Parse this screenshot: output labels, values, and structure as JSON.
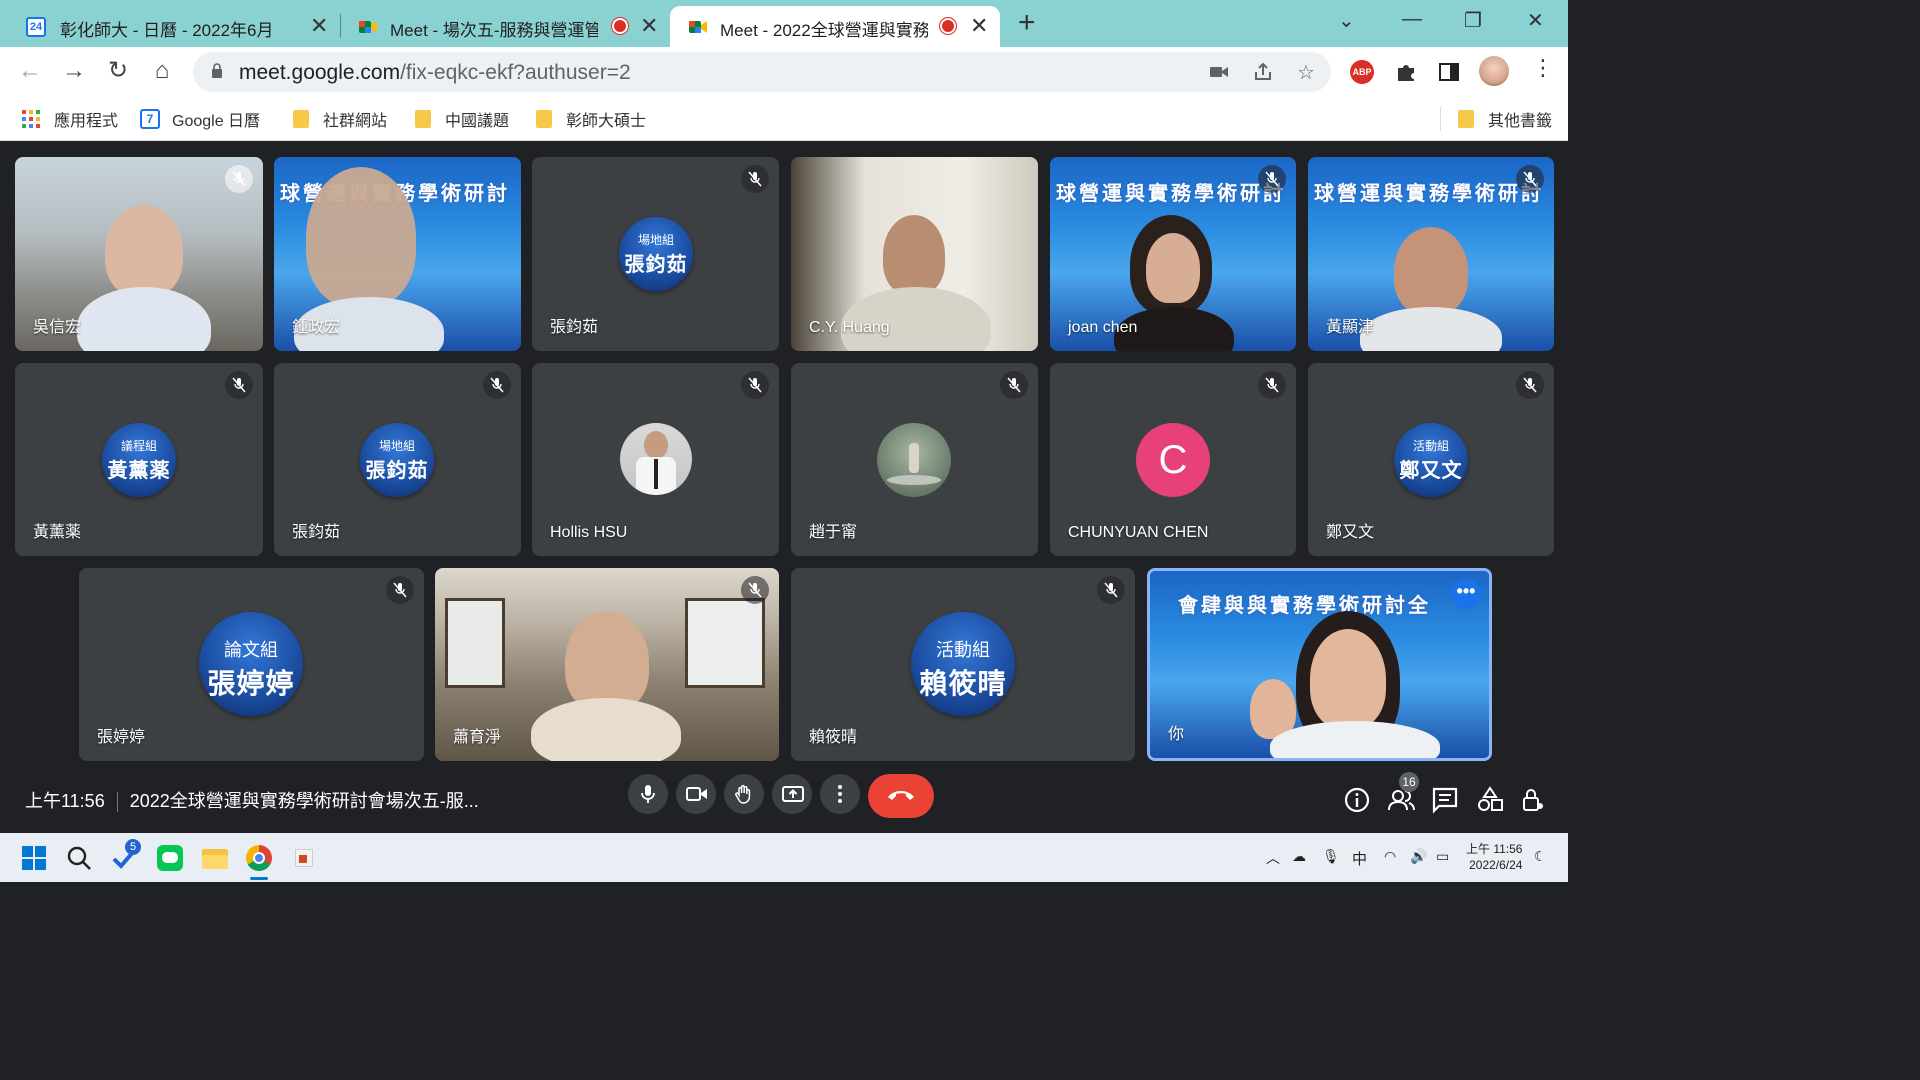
{
  "browser": {
    "tabs": [
      {
        "title": "彰化師大 - 日曆 - 2022年6月",
        "favicon": "calendar-icon",
        "favicon_text": "24",
        "recording": false,
        "active": false
      },
      {
        "title": "Meet - 場次五-服務與營運管",
        "favicon": "meet-icon",
        "recording": true,
        "active": false
      },
      {
        "title": "Meet - 2022全球營運與實務",
        "favicon": "meet-icon",
        "recording": true,
        "active": true
      }
    ],
    "url_host": "meet.google.com",
    "url_path": "/fix-eqkc-ekf?authuser=2",
    "bookmarks": [
      {
        "label": "應用程式",
        "icon": "apps-grid-icon"
      },
      {
        "label": "Google 日曆",
        "icon": "calendar-icon",
        "icon_text": "7"
      },
      {
        "label": "社群網站",
        "icon": "folder-icon"
      },
      {
        "label": "中國議題",
        "icon": "folder-icon"
      },
      {
        "label": "彰師大碩士",
        "icon": "folder-icon"
      }
    ],
    "other_bookmarks": "其他書籤",
    "extension_abp": "ABP"
  },
  "meeting": {
    "time": "上午11:56",
    "title": "2022全球營運與實務學術研討會場次五-服...",
    "participant_count": "16",
    "banner_text": "球營運與實務學術研討",
    "self_banner_text": "會肆與與實務學術研討全",
    "tiles": [
      {
        "name": "吳信宏",
        "kind": "video"
      },
      {
        "name": "鍾政宏",
        "kind": "video"
      },
      {
        "name": "張鈞茹",
        "kind": "badge",
        "role": "場地組",
        "badge_name": "張鈞茹"
      },
      {
        "name": "C.Y. Huang",
        "kind": "video"
      },
      {
        "name": "joan chen",
        "kind": "video"
      },
      {
        "name": "黃顯津",
        "kind": "video"
      },
      {
        "name": "黃薰薬",
        "kind": "badge",
        "role": "議程組",
        "badge_name": "黃薰薬"
      },
      {
        "name": "張鈞茹",
        "kind": "badge",
        "role": "場地組",
        "badge_name": "張鈞茹"
      },
      {
        "name": "Hollis HSU",
        "kind": "photo"
      },
      {
        "name": "趙于甯",
        "kind": "photo"
      },
      {
        "name": "CHUNYUAN CHEN",
        "kind": "letter",
        "letter": "C"
      },
      {
        "name": "鄭又文",
        "kind": "badge",
        "role": "活動組",
        "badge_name": "鄭又文"
      },
      {
        "name": "張婷婷",
        "kind": "badge",
        "role": "論文組",
        "badge_name": "張婷婷"
      },
      {
        "name": "蕭育淨",
        "kind": "video"
      },
      {
        "name": "賴筱晴",
        "kind": "badge",
        "role": "活動組",
        "badge_name": "賴筱晴"
      },
      {
        "name": "你",
        "kind": "self"
      }
    ]
  },
  "taskbar": {
    "todo_badge": "5",
    "ime": "中",
    "time": "上午 11:56",
    "date": "2022/6/24"
  }
}
